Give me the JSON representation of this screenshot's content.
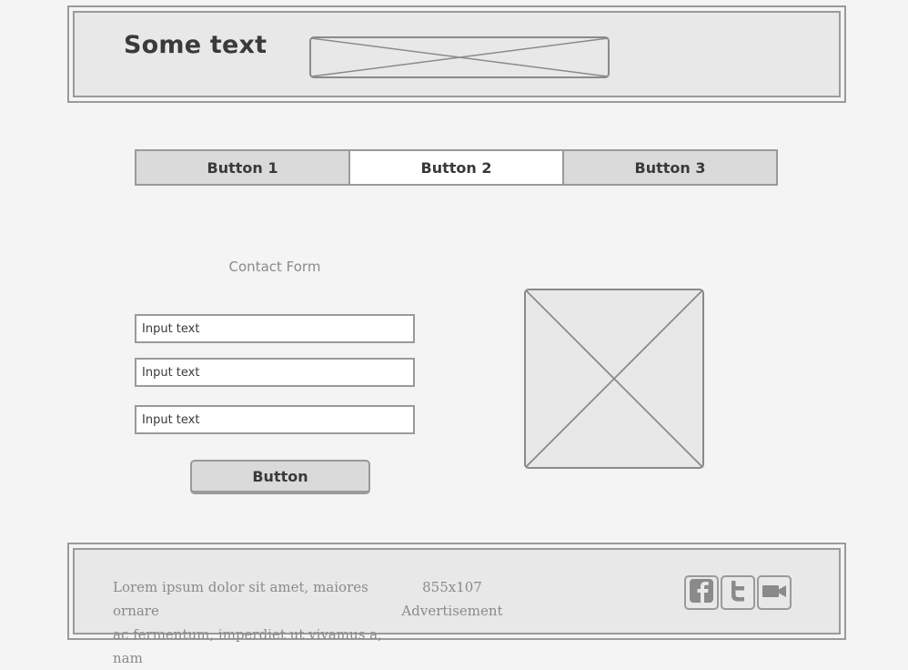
{
  "header": {
    "title": "Some text"
  },
  "tabs": [
    {
      "label": "Button 1",
      "active": false
    },
    {
      "label": "Button 2",
      "active": true
    },
    {
      "label": "Button 3",
      "active": false
    }
  ],
  "contact_form": {
    "title": "Contact Form",
    "inputs": [
      {
        "placeholder": "Input text"
      },
      {
        "placeholder": "Input text"
      },
      {
        "placeholder": "Input text"
      }
    ],
    "submit_label": "Button"
  },
  "footer": {
    "lorem_line1": "Lorem ipsum dolor sit amet, maiores ornare",
    "lorem_line2": "ac fermentum, imperdiet ut vivamus a, nam",
    "ad_size": "855x107",
    "ad_label": "Advertisement",
    "social": [
      "facebook-icon",
      "twitter-icon",
      "video-camera-icon"
    ]
  },
  "colors": {
    "background": "#f4f4f4",
    "panel": "#e8e8e8",
    "border": "#9a9a9a",
    "button": "#dadada",
    "text_dark": "#3a3a3a",
    "text_muted": "#8a8a8a"
  }
}
